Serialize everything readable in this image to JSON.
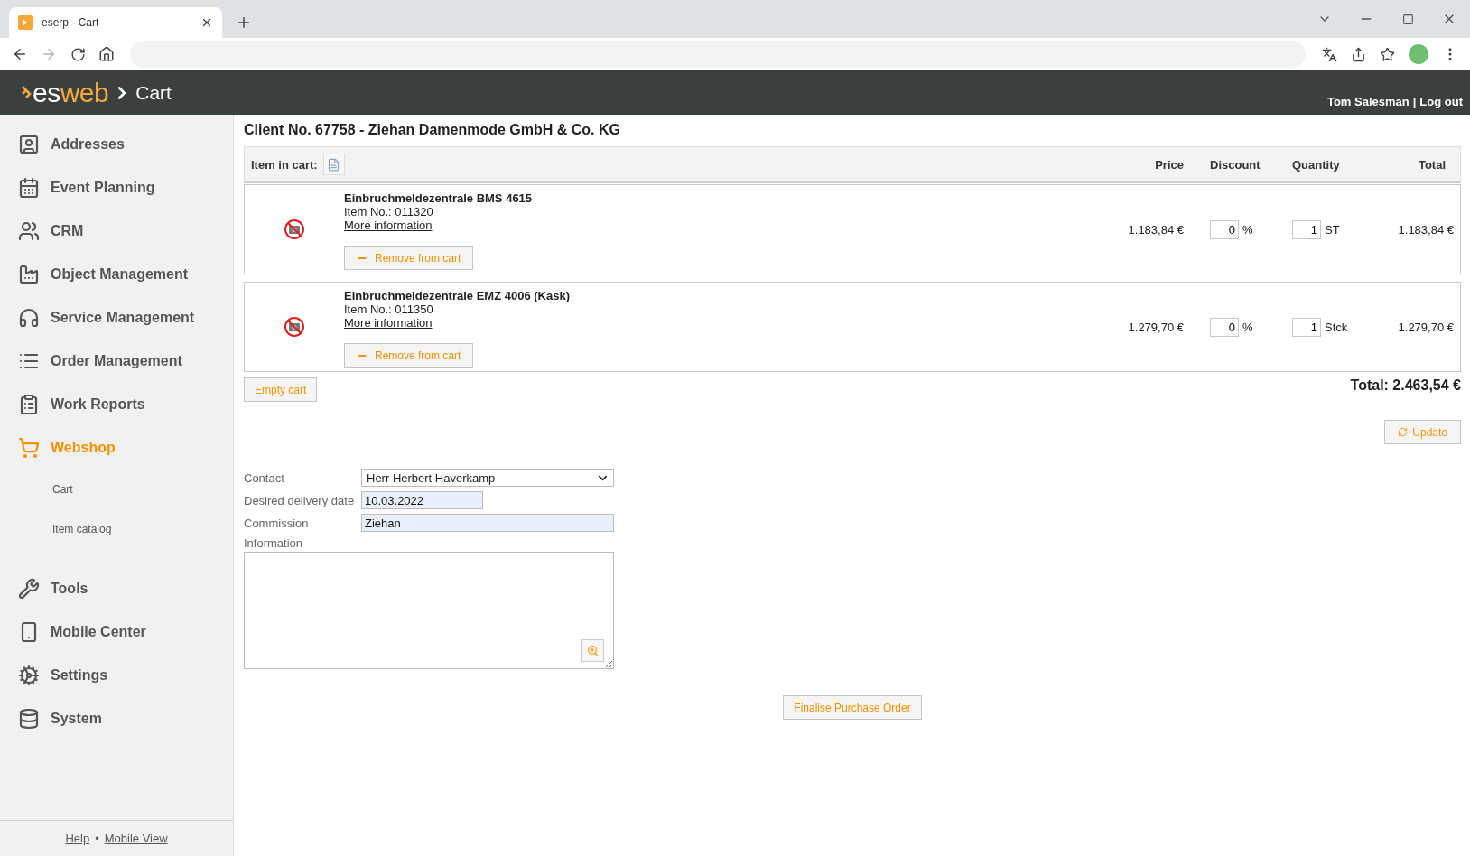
{
  "browser": {
    "tab_title": "eserp - Cart",
    "forward_disabled": true
  },
  "app_header": {
    "logo_first": "es",
    "logo_second": "web",
    "page": "Cart",
    "user": "Tom Salesman",
    "divider": "|",
    "logout": "Log out"
  },
  "sidebar": {
    "items": [
      {
        "label": "Addresses",
        "selected": false
      },
      {
        "label": "Event Planning",
        "selected": false
      },
      {
        "label": "CRM",
        "selected": false
      },
      {
        "label": "Object Management",
        "selected": false
      },
      {
        "label": "Service Management",
        "selected": false
      },
      {
        "label": "Order Management",
        "selected": false
      },
      {
        "label": "Work Reports",
        "selected": false
      },
      {
        "label": "Webshop",
        "selected": true,
        "children": [
          {
            "label": "Cart"
          },
          {
            "label": "Item catalog"
          }
        ]
      },
      {
        "label": "Tools",
        "selected": false
      },
      {
        "label": "Mobile Center",
        "selected": false
      },
      {
        "label": "Settings",
        "selected": false
      },
      {
        "label": "System",
        "selected": false
      }
    ],
    "footer": {
      "help": "Help",
      "separator": "•",
      "mobile_view": "Mobile View"
    }
  },
  "title": "Client No. 67758 - Ziehan Damenmode GmbH & Co. KG",
  "cart": {
    "header": {
      "items_label": "Item in cart:",
      "columns": [
        "Price",
        "Discount",
        "Quantity",
        "Total"
      ]
    },
    "rows": [
      {
        "name": "Einbruchmeldezentrale BMS 4615",
        "item_no": "Item No.: 011320",
        "more_info": "More information",
        "remove": "Remove from cart",
        "price": "1.183,84 €",
        "discount": "0",
        "discount_unit": "%",
        "quantity": "1",
        "unit": "ST",
        "total": "1.183,84 €"
      },
      {
        "name": "Einbruchmeldezentrale EMZ 4006 (Kask)",
        "item_no": "Item No.: 011350",
        "more_info": "More information",
        "remove": "Remove from cart",
        "price": "1.279,70 €",
        "discount": "0",
        "discount_unit": "%",
        "quantity": "1",
        "unit": "Stck",
        "total": "1.279,70 €"
      }
    ],
    "empty_cart": "Empty cart",
    "grand_total": "Total: 2.463,54 €",
    "update": "Update"
  },
  "form": {
    "contact_label": "Contact",
    "contact_value": "Herr Herbert Haverkamp",
    "date_label": "Desired delivery date",
    "date_value": "10.03.2022",
    "commission_label": "Commission",
    "commission_value": "Ziehan",
    "information_label": "Information"
  },
  "finalise": "Finalise Purchase Order"
}
